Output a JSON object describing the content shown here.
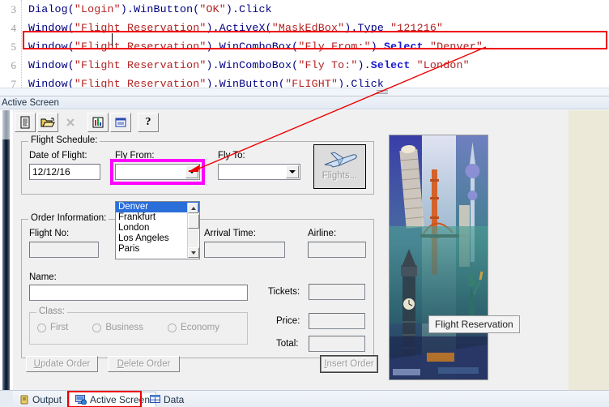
{
  "editor": {
    "line_numbers": [
      "3",
      "4",
      "5",
      "6",
      "7"
    ],
    "lines": [
      {
        "id": "l3",
        "plain": "Dialog(\"Login\").WinButton(\"OK\").Click",
        "tokens": [
          {
            "t": "Dialog(",
            "c": "id"
          },
          {
            "t": "\"Login\"",
            "c": "str"
          },
          {
            "t": ").WinButton(",
            "c": "id"
          },
          {
            "t": "\"OK\"",
            "c": "str"
          },
          {
            "t": ").Click",
            "c": "id"
          }
        ]
      },
      {
        "id": "l4",
        "plain": "Window(\"Flight Reservation\").ActiveX(\"MaskEdBox\").Type \"121216\"",
        "tokens": [
          {
            "t": "Window(",
            "c": "id"
          },
          {
            "t": "\"Flight Reservation\"",
            "c": "str"
          },
          {
            "t": ").ActiveX(",
            "c": "id"
          },
          {
            "t": "\"MaskEdBox\"",
            "c": "str"
          },
          {
            "t": ").Type ",
            "c": "id"
          },
          {
            "t": "\"121216\"",
            "c": "str"
          }
        ]
      },
      {
        "id": "l5",
        "plain": "Window(\"Flight Reservation\").WinComboBox(\"Fly From:\").Select \"Denver\"",
        "tokens": [
          {
            "t": "Window(",
            "c": "id"
          },
          {
            "t": "\"Flight Reservation\"",
            "c": "str"
          },
          {
            "t": ").WinComboBox(",
            "c": "id"
          },
          {
            "t": "\"Fly From:\"",
            "c": "str"
          },
          {
            "t": ").",
            "c": "id"
          },
          {
            "t": "Select",
            "c": "kw"
          },
          {
            "t": " ",
            "c": "id"
          },
          {
            "t": "\"Denver\"",
            "c": "str"
          }
        ]
      },
      {
        "id": "l6",
        "plain": "Window(\"Flight Reservation\").WinComboBox(\"Fly To:\").Select \"London\"",
        "tokens": [
          {
            "t": "Window(",
            "c": "id"
          },
          {
            "t": "\"Flight Reservation\"",
            "c": "str"
          },
          {
            "t": ").WinComboBox(",
            "c": "id"
          },
          {
            "t": "\"Fly To:\"",
            "c": "str"
          },
          {
            "t": ").",
            "c": "id"
          },
          {
            "t": "Select",
            "c": "kw"
          },
          {
            "t": " ",
            "c": "id"
          },
          {
            "t": "\"London\"",
            "c": "str"
          }
        ]
      },
      {
        "id": "l7",
        "plain": "Window(\"Flight Reservation\").WinButton(\"FLIGHT\").Click",
        "tokens": [
          {
            "t": "Window(",
            "c": "id"
          },
          {
            "t": "\"Flight Reservation\"",
            "c": "str"
          },
          {
            "t": ").WinButton(",
            "c": "id"
          },
          {
            "t": "\"FLIGHT\"",
            "c": "str"
          },
          {
            "t": ").Click",
            "c": "id"
          }
        ]
      }
    ],
    "highlighted_line_index": 2,
    "highlight_color": "#ee0000"
  },
  "active_screen": {
    "panel_title": "Active Screen",
    "toolbar": [
      {
        "name": "new-document-icon",
        "label": "New"
      },
      {
        "name": "open-folder-icon",
        "label": "Open"
      },
      {
        "name": "close-x-icon",
        "label": "Close",
        "disabled": true
      },
      {
        "name": "chart-icon",
        "label": "Chart"
      },
      {
        "name": "report-icon",
        "label": "Report"
      },
      {
        "name": "help-icon",
        "label": "Help"
      }
    ],
    "tooltip": "Flight Reservation"
  },
  "flight_form": {
    "schedule_group": "Flight Schedule:",
    "date_label": "Date of Flight:",
    "date_value": "12/12/16",
    "fly_from_label": "Fly From:",
    "fly_from_value": "",
    "fly_to_label": "Fly To:",
    "fly_to_value": "",
    "flights_button": "Flights...",
    "dropdown_options": [
      "Denver",
      "Frankfurt",
      "London",
      "Los Angeles",
      "Paris"
    ],
    "dropdown_selected": "Denver",
    "highlight_color": "#ff00ff",
    "order_group": "Order Information:",
    "flight_no_label": "Flight No:",
    "flight_no_value": "",
    "arrival_time_label": "Arrival Time:",
    "arrival_time_value": "",
    "airline_label": "Airline:",
    "airline_value": "",
    "name_label": "Name:",
    "name_value": "",
    "class_group": "Class:",
    "class_options": [
      "First",
      "Business",
      "Economy"
    ],
    "tickets_label": "Tickets:",
    "tickets_value": "",
    "price_label": "Price:",
    "price_value": "",
    "total_label": "Total:",
    "total_value": "",
    "update_order_button": "Update Order",
    "delete_order_button": "Delete Order",
    "insert_order_button": "Insert Order"
  },
  "tabs": {
    "items": [
      {
        "label": "Output",
        "icon": "output-icon",
        "active": false
      },
      {
        "label": "Active Screen",
        "icon": "active-screen-icon",
        "active": true
      },
      {
        "label": "Data",
        "icon": "data-table-icon",
        "active": false
      }
    ],
    "highlight_color": "#ee0000"
  },
  "annotations": {
    "arrow_color": "#ee0000",
    "arrow_from": "code line 5 Select Denver",
    "arrow_to": "Fly From combo box"
  }
}
